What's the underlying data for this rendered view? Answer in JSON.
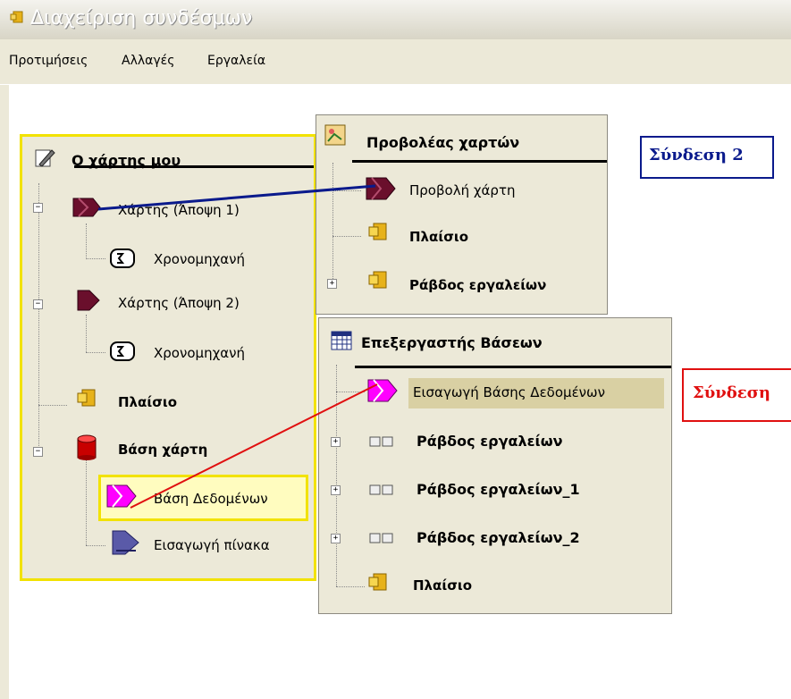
{
  "window": {
    "title": "Διαχείριση συνδέσμων"
  },
  "menu": [
    "Προτιμήσεις",
    "Αλλαγές",
    "Εργαλεία"
  ],
  "panel_map": {
    "title": "Ο χάρτης μου",
    "nodes": [
      {
        "label": "Χάρτης (Άποψη 1)"
      },
      {
        "label": "Χρονομηχανή"
      },
      {
        "label": "Χάρτης (Άποψη 2)"
      },
      {
        "label": "Χρονομηχανή"
      },
      {
        "label": "Πλαίσιο"
      },
      {
        "label": "Βάση χάρτη"
      },
      {
        "label": "Βάση Δεδομένων"
      },
      {
        "label": "Εισαγωγή πίνακα"
      }
    ]
  },
  "panel_viewer": {
    "title": "Προβολέας χαρτών",
    "nodes": [
      {
        "label": "Προβολή χάρτη"
      },
      {
        "label": "Πλαίσιο"
      },
      {
        "label": "Ράβδος εργαλείων"
      }
    ]
  },
  "panel_db": {
    "title": "Επεξεργαστής Βάσεων",
    "nodes": [
      {
        "label": "Εισαγωγή Βάσης Δεδομένων"
      },
      {
        "label": "Ράβδος εργαλείων"
      },
      {
        "label": "Ράβδος εργαλείων_1"
      },
      {
        "label": "Ράβδος εργαλείων_2"
      },
      {
        "label": "Πλαίσιο"
      }
    ]
  },
  "links": [
    {
      "label": "Σύνδεση 2",
      "color": "#0a1a8c"
    },
    {
      "label": "Σύνδεση",
      "color": "#e01010"
    }
  ]
}
